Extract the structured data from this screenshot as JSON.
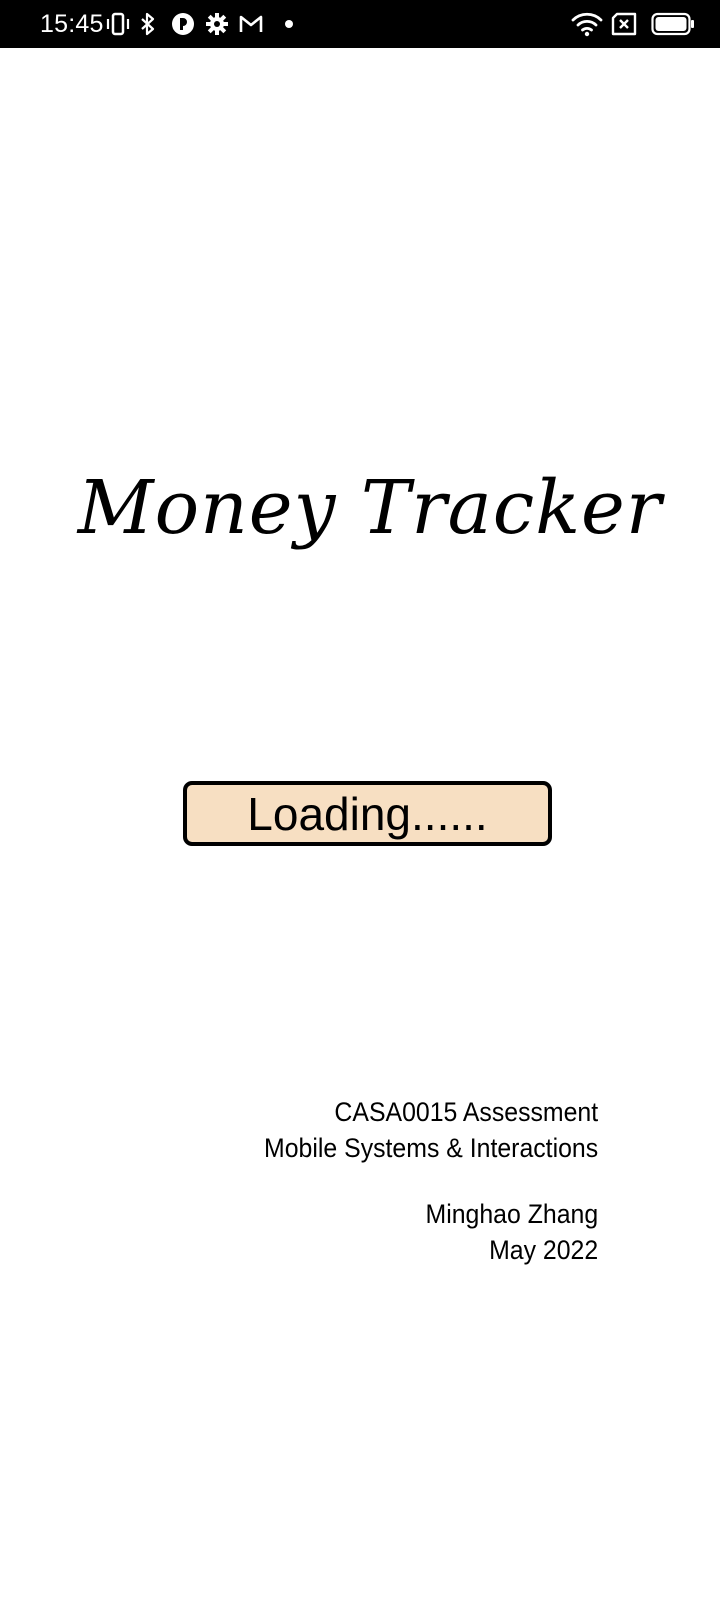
{
  "status_bar": {
    "time": "15:45",
    "left_icons": [
      "vibrate-icon",
      "bluetooth-icon",
      "app-badge-icon",
      "settings-gear-icon",
      "gmail-icon",
      "notification-dot-icon"
    ],
    "right_icons": [
      "wifi-icon",
      "sim-no-signal-icon",
      "battery-icon"
    ]
  },
  "splash": {
    "title": "Money Tracker",
    "loading_label": "Loading......",
    "course_code": "CASA0015 Assessment",
    "course_name": "Mobile Systems & Interactions",
    "author": "Minghao Zhang",
    "date": "May 2022"
  },
  "colors": {
    "status_bar_bg": "#000000",
    "background": "#ffffff",
    "loading_box_fill": "#f7dfc2",
    "loading_box_border": "#000000"
  }
}
